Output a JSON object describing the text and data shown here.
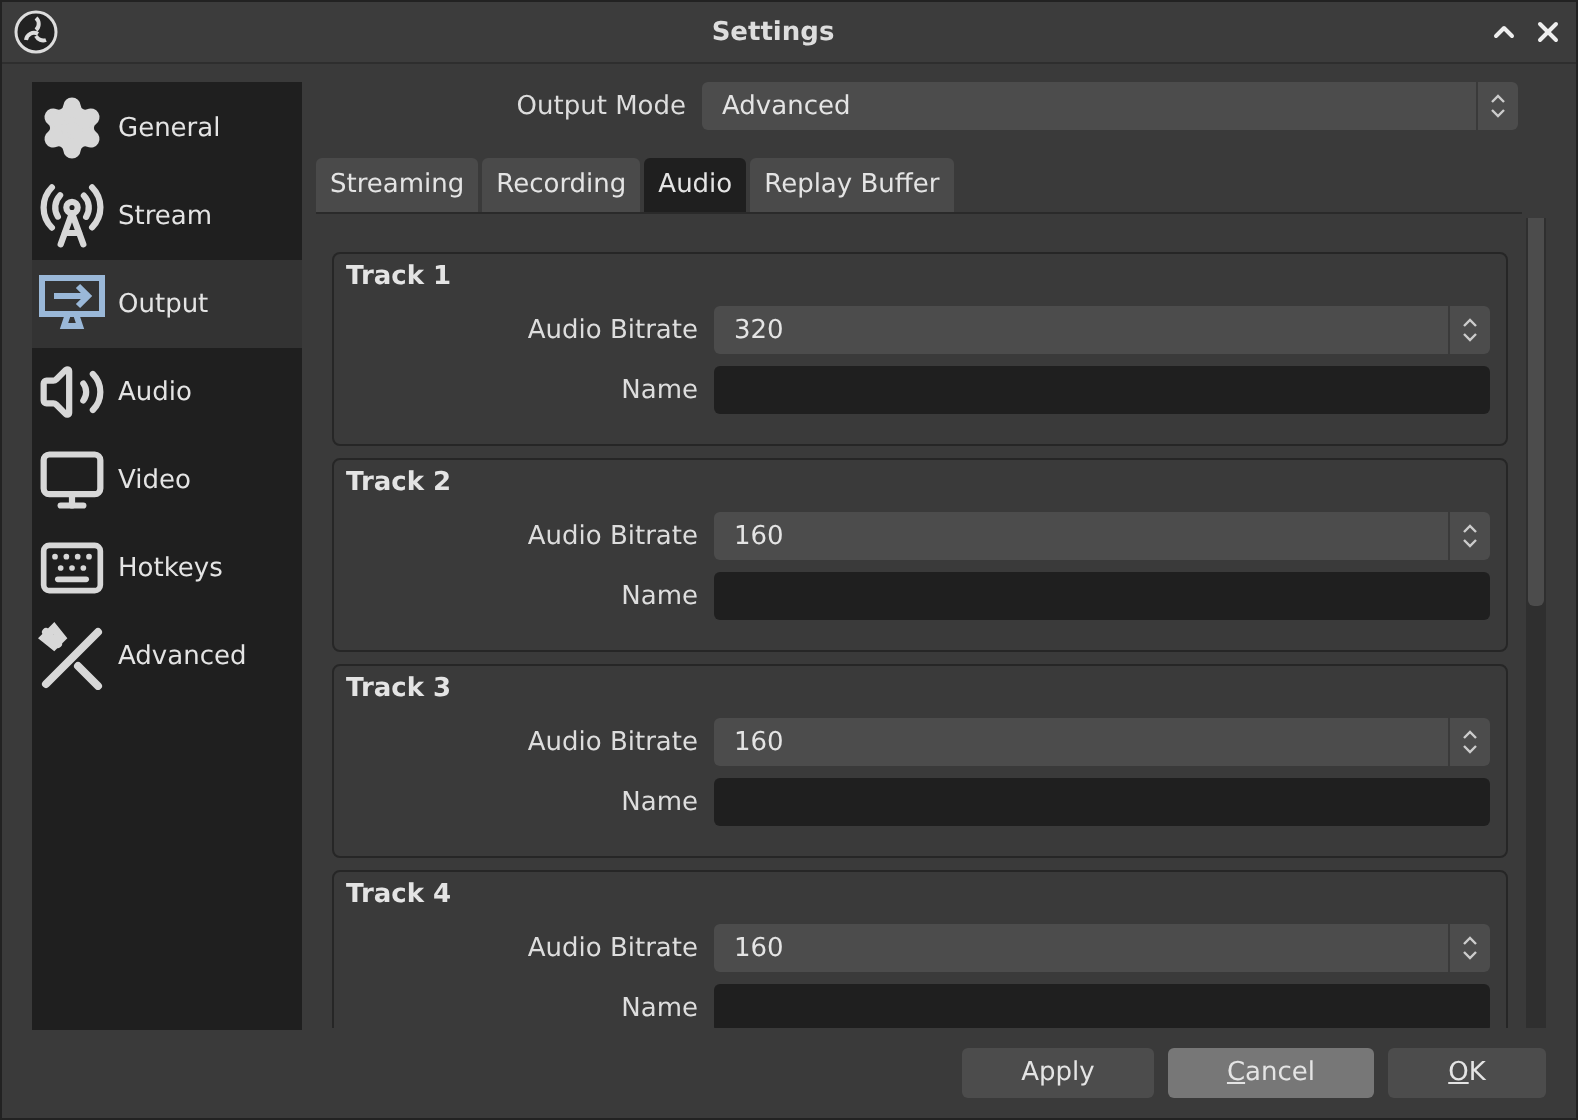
{
  "window": {
    "title": "Settings"
  },
  "sidebar": {
    "items": [
      {
        "label": "General",
        "selected": false
      },
      {
        "label": "Stream",
        "selected": false
      },
      {
        "label": "Output",
        "selected": true
      },
      {
        "label": "Audio",
        "selected": false
      },
      {
        "label": "Video",
        "selected": false
      },
      {
        "label": "Hotkeys",
        "selected": false
      },
      {
        "label": "Advanced",
        "selected": false
      }
    ]
  },
  "output_mode": {
    "label": "Output Mode",
    "value": "Advanced"
  },
  "tabs": [
    {
      "label": "Streaming",
      "selected": false
    },
    {
      "label": "Recording",
      "selected": false
    },
    {
      "label": "Audio",
      "selected": true
    },
    {
      "label": "Replay Buffer",
      "selected": false
    }
  ],
  "tracks": [
    {
      "title": "Track 1",
      "bitrate_label": "Audio Bitrate",
      "bitrate": "320",
      "name_label": "Name"
    },
    {
      "title": "Track 2",
      "bitrate_label": "Audio Bitrate",
      "bitrate": "160",
      "name_label": "Name"
    },
    {
      "title": "Track 3",
      "bitrate_label": "Audio Bitrate",
      "bitrate": "160",
      "name_label": "Name"
    },
    {
      "title": "Track 4",
      "bitrate_label": "Audio Bitrate",
      "bitrate": "160",
      "name_label": "Name"
    }
  ],
  "buttons": [
    {
      "label": "Apply",
      "hovered": false,
      "mnemonic": false
    },
    {
      "label": "Cancel",
      "hovered": true,
      "mnemonic": true
    },
    {
      "label": "OK",
      "hovered": false,
      "mnemonic": true
    }
  ]
}
